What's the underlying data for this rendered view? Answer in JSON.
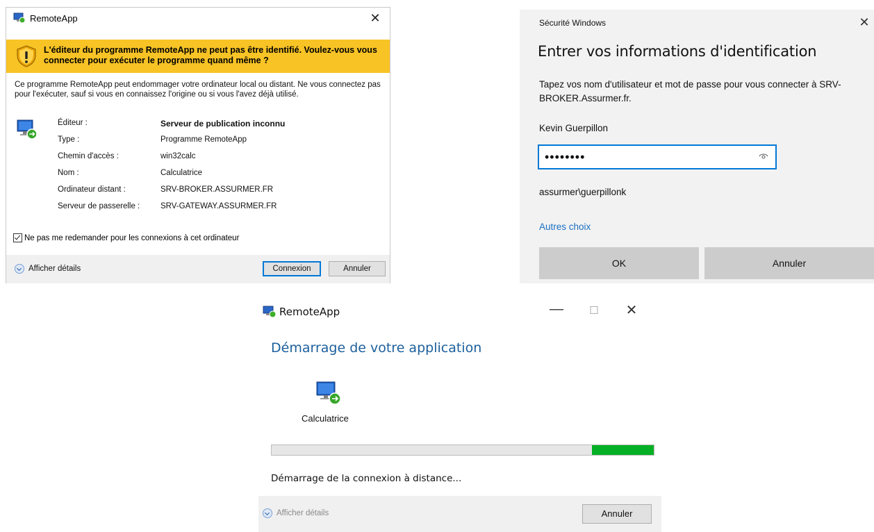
{
  "remoteapp_warning": {
    "title": "RemoteApp",
    "warning_heading": "L'éditeur du programme RemoteApp ne peut pas être identifié. Voulez-vous vous connecter pour exécuter le programme quand même ?",
    "description": "Ce programme RemoteApp peut endommager votre ordinateur local ou distant. Ne vous connectez pas pour l'exécuter, sauf si vous en connaissez l'origine ou si vous l'avez déjà utilisé.",
    "details": [
      {
        "label": "Éditeur :",
        "value": "Serveur de publication inconnu"
      },
      {
        "label": "Type :",
        "value": "Programme RemoteApp"
      },
      {
        "label": "Chemin d'accès :",
        "value": "win32calc"
      },
      {
        "label": "Nom :",
        "value": "Calculatrice"
      },
      {
        "label": "Ordinateur distant :",
        "value": "SRV-BROKER.ASSURMER.FR"
      },
      {
        "label": "Serveur de passerelle :",
        "value": "SRV-GATEWAY.ASSURMER.FR"
      }
    ],
    "dont_ask_label": "Ne pas me redemander pour les connexions à cet ordinateur",
    "dont_ask_checked": true,
    "show_details_label": "Afficher détails",
    "connect_label": "Connexion",
    "cancel_label": "Annuler",
    "close_glyph": "✕"
  },
  "windows_security": {
    "small_title": "Sécurité Windows",
    "title": "Entrer vos informations d'identification",
    "instructions": "Tapez vos nom d'utilisateur et mot de passe pour vous connecter à SRV-BROKER.Assurmer.fr.",
    "username": "Kevin Guerpillon",
    "password_mask": "••••••••",
    "domain_user": "assurmer\\guerpillonk",
    "other_choices": "Autres choix",
    "ok_label": "OK",
    "cancel_label": "Annuler",
    "close_glyph": "✕"
  },
  "remoteapp_progress": {
    "title": "RemoteApp",
    "minimize_glyph": "—",
    "maximize_glyph": "☐",
    "close_glyph": "✕",
    "heading": "Démarrage de votre application",
    "app_name": "Calculatrice",
    "progress_start": 0.839,
    "progress_end": 1.0,
    "status": "Démarrage de la connexion à distance...",
    "show_details_label": "Afficher détails",
    "cancel_label": "Annuler"
  },
  "colors": {
    "warning_banner": "#f7c325",
    "accent": "#0078d7",
    "progress_fill": "#06b025",
    "heading_blue": "#1c5f9c",
    "link_blue": "#1a6fc4"
  }
}
